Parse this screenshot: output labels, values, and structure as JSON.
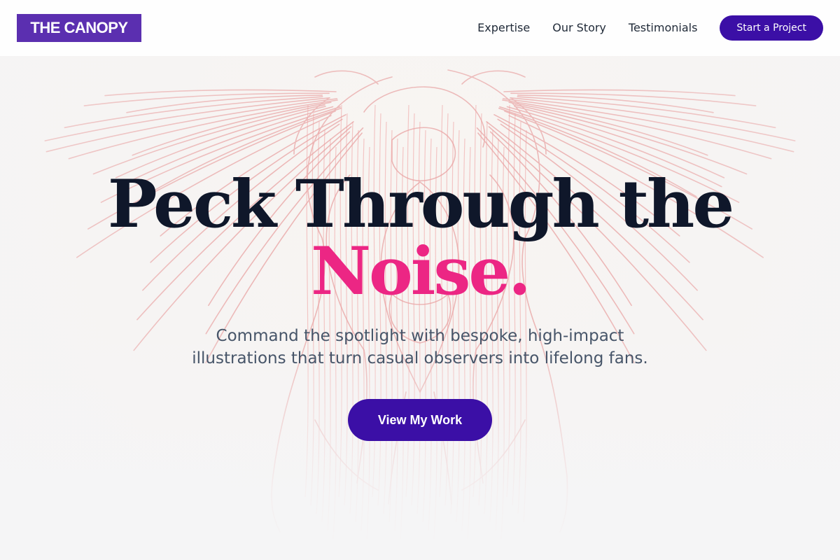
{
  "brand": {
    "logo_text": "THE CANOPY",
    "logo_color": "#5b2fb0"
  },
  "nav": {
    "links": [
      {
        "label": "Expertise"
      },
      {
        "label": "Our Story"
      },
      {
        "label": "Testimonials"
      }
    ],
    "cta_label": "Start a Project",
    "cta_color": "#3b0fa6"
  },
  "hero": {
    "headline_main": "Peck Through the",
    "headline_accent": "Noise.",
    "accent_color": "#ec2684",
    "subtext": "Command the spotlight with bespoke, high-impact illustrations that turn casual observers into lifelong fans.",
    "cta_label": "View My Work",
    "background_art": "line-engraving-figures-with-wings"
  }
}
